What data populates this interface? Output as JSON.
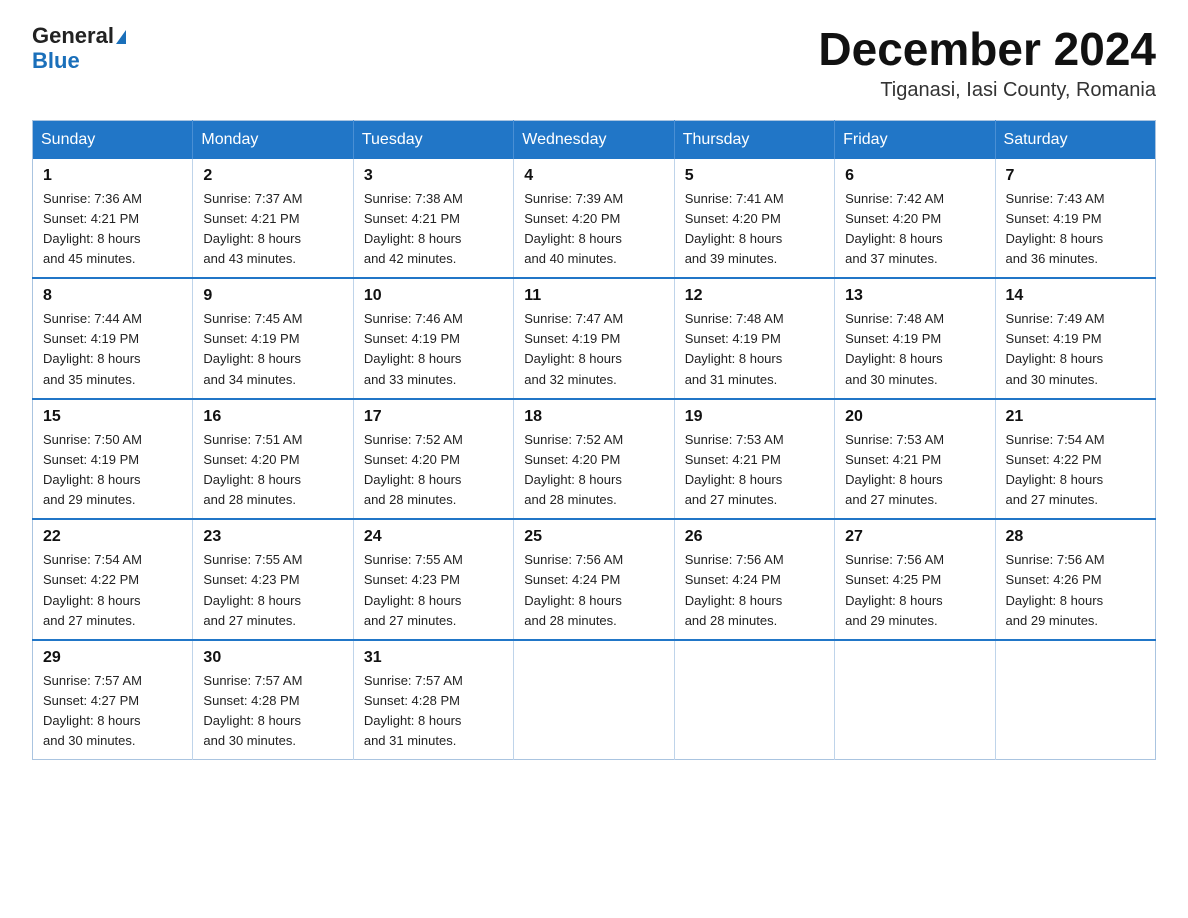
{
  "logo": {
    "general": "General",
    "triangle": "▶",
    "blue": "Blue"
  },
  "title": {
    "month": "December 2024",
    "location": "Tiganasi, Iasi County, Romania"
  },
  "weekdays": [
    "Sunday",
    "Monday",
    "Tuesday",
    "Wednesday",
    "Thursday",
    "Friday",
    "Saturday"
  ],
  "weeks": [
    [
      {
        "day": "1",
        "sunrise": "7:36 AM",
        "sunset": "4:21 PM",
        "daylight": "8 hours and 45 minutes."
      },
      {
        "day": "2",
        "sunrise": "7:37 AM",
        "sunset": "4:21 PM",
        "daylight": "8 hours and 43 minutes."
      },
      {
        "day": "3",
        "sunrise": "7:38 AM",
        "sunset": "4:21 PM",
        "daylight": "8 hours and 42 minutes."
      },
      {
        "day": "4",
        "sunrise": "7:39 AM",
        "sunset": "4:20 PM",
        "daylight": "8 hours and 40 minutes."
      },
      {
        "day": "5",
        "sunrise": "7:41 AM",
        "sunset": "4:20 PM",
        "daylight": "8 hours and 39 minutes."
      },
      {
        "day": "6",
        "sunrise": "7:42 AM",
        "sunset": "4:20 PM",
        "daylight": "8 hours and 37 minutes."
      },
      {
        "day": "7",
        "sunrise": "7:43 AM",
        "sunset": "4:19 PM",
        "daylight": "8 hours and 36 minutes."
      }
    ],
    [
      {
        "day": "8",
        "sunrise": "7:44 AM",
        "sunset": "4:19 PM",
        "daylight": "8 hours and 35 minutes."
      },
      {
        "day": "9",
        "sunrise": "7:45 AM",
        "sunset": "4:19 PM",
        "daylight": "8 hours and 34 minutes."
      },
      {
        "day": "10",
        "sunrise": "7:46 AM",
        "sunset": "4:19 PM",
        "daylight": "8 hours and 33 minutes."
      },
      {
        "day": "11",
        "sunrise": "7:47 AM",
        "sunset": "4:19 PM",
        "daylight": "8 hours and 32 minutes."
      },
      {
        "day": "12",
        "sunrise": "7:48 AM",
        "sunset": "4:19 PM",
        "daylight": "8 hours and 31 minutes."
      },
      {
        "day": "13",
        "sunrise": "7:48 AM",
        "sunset": "4:19 PM",
        "daylight": "8 hours and 30 minutes."
      },
      {
        "day": "14",
        "sunrise": "7:49 AM",
        "sunset": "4:19 PM",
        "daylight": "8 hours and 30 minutes."
      }
    ],
    [
      {
        "day": "15",
        "sunrise": "7:50 AM",
        "sunset": "4:19 PM",
        "daylight": "8 hours and 29 minutes."
      },
      {
        "day": "16",
        "sunrise": "7:51 AM",
        "sunset": "4:20 PM",
        "daylight": "8 hours and 28 minutes."
      },
      {
        "day": "17",
        "sunrise": "7:52 AM",
        "sunset": "4:20 PM",
        "daylight": "8 hours and 28 minutes."
      },
      {
        "day": "18",
        "sunrise": "7:52 AM",
        "sunset": "4:20 PM",
        "daylight": "8 hours and 28 minutes."
      },
      {
        "day": "19",
        "sunrise": "7:53 AM",
        "sunset": "4:21 PM",
        "daylight": "8 hours and 27 minutes."
      },
      {
        "day": "20",
        "sunrise": "7:53 AM",
        "sunset": "4:21 PM",
        "daylight": "8 hours and 27 minutes."
      },
      {
        "day": "21",
        "sunrise": "7:54 AM",
        "sunset": "4:22 PM",
        "daylight": "8 hours and 27 minutes."
      }
    ],
    [
      {
        "day": "22",
        "sunrise": "7:54 AM",
        "sunset": "4:22 PM",
        "daylight": "8 hours and 27 minutes."
      },
      {
        "day": "23",
        "sunrise": "7:55 AM",
        "sunset": "4:23 PM",
        "daylight": "8 hours and 27 minutes."
      },
      {
        "day": "24",
        "sunrise": "7:55 AM",
        "sunset": "4:23 PM",
        "daylight": "8 hours and 27 minutes."
      },
      {
        "day": "25",
        "sunrise": "7:56 AM",
        "sunset": "4:24 PM",
        "daylight": "8 hours and 28 minutes."
      },
      {
        "day": "26",
        "sunrise": "7:56 AM",
        "sunset": "4:24 PM",
        "daylight": "8 hours and 28 minutes."
      },
      {
        "day": "27",
        "sunrise": "7:56 AM",
        "sunset": "4:25 PM",
        "daylight": "8 hours and 29 minutes."
      },
      {
        "day": "28",
        "sunrise": "7:56 AM",
        "sunset": "4:26 PM",
        "daylight": "8 hours and 29 minutes."
      }
    ],
    [
      {
        "day": "29",
        "sunrise": "7:57 AM",
        "sunset": "4:27 PM",
        "daylight": "8 hours and 30 minutes."
      },
      {
        "day": "30",
        "sunrise": "7:57 AM",
        "sunset": "4:28 PM",
        "daylight": "8 hours and 30 minutes."
      },
      {
        "day": "31",
        "sunrise": "7:57 AM",
        "sunset": "4:28 PM",
        "daylight": "8 hours and 31 minutes."
      },
      null,
      null,
      null,
      null
    ]
  ],
  "labels": {
    "sunrise": "Sunrise:",
    "sunset": "Sunset:",
    "daylight": "Daylight:"
  }
}
